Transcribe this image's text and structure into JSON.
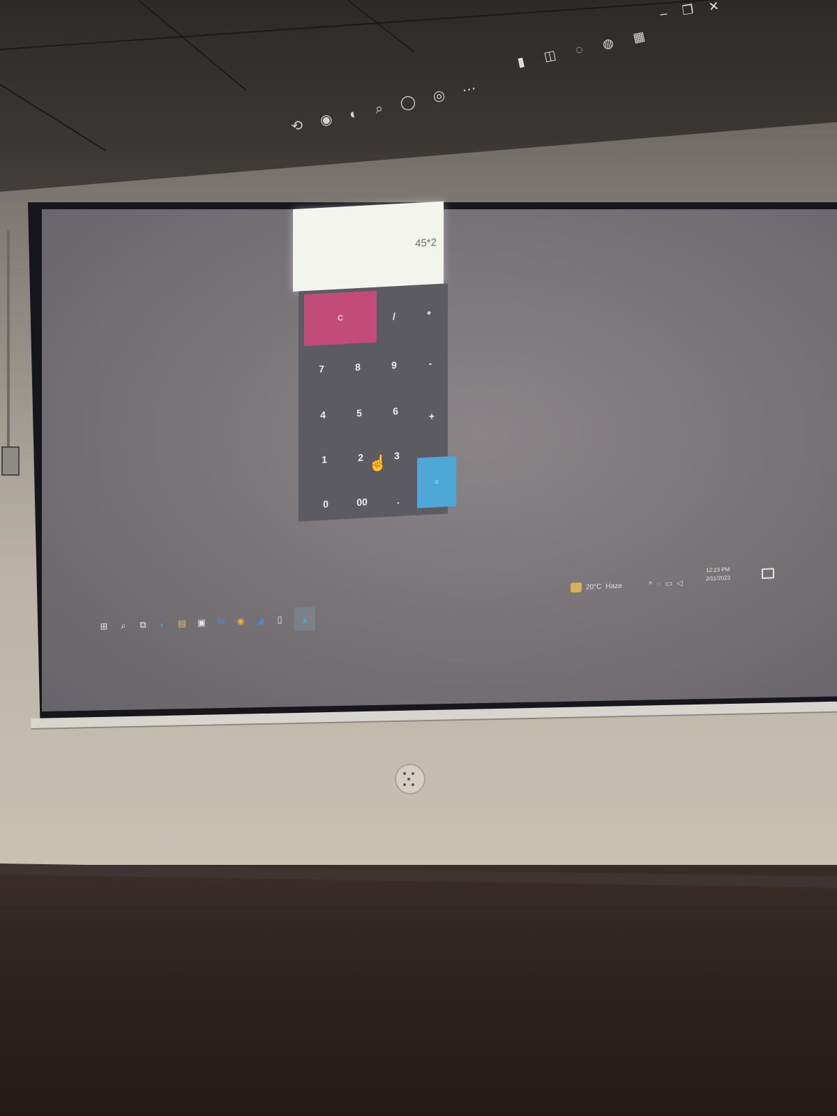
{
  "window": {
    "title": "",
    "controls": [
      "minimize-icon",
      "restore-icon",
      "close-icon"
    ]
  },
  "calculator": {
    "display": "45*2",
    "keys": {
      "clear": "C",
      "divide": "/",
      "multiply": "*",
      "subtract": "-",
      "add": "+",
      "seven": "7",
      "eight": "8",
      "nine": "9",
      "four": "4",
      "five": "5",
      "six": "6",
      "one": "1",
      "two": "2",
      "three": "3",
      "zero": "0",
      "double_zero": "00",
      "decimal": ".",
      "equals": "="
    },
    "colors": {
      "display_bg": "#f4f4ef",
      "keypad_bg": "#5c5b61",
      "clear_key": "#c34b77",
      "equals_key": "#4ea7d6"
    }
  },
  "taskbar": {
    "icons": [
      "windows-start-icon",
      "search-icon",
      "task-view-icon",
      "edge-browser-icon",
      "file-explorer-icon",
      "store-icon",
      "mail-icon",
      "chrome-icon",
      "vscode-icon",
      "document-icon",
      "calculator-app-icon"
    ],
    "weather": {
      "temperature": "20°C",
      "condition": "Haze"
    },
    "clock": {
      "time": "12:23 PM",
      "date": "2/11/2023"
    }
  }
}
